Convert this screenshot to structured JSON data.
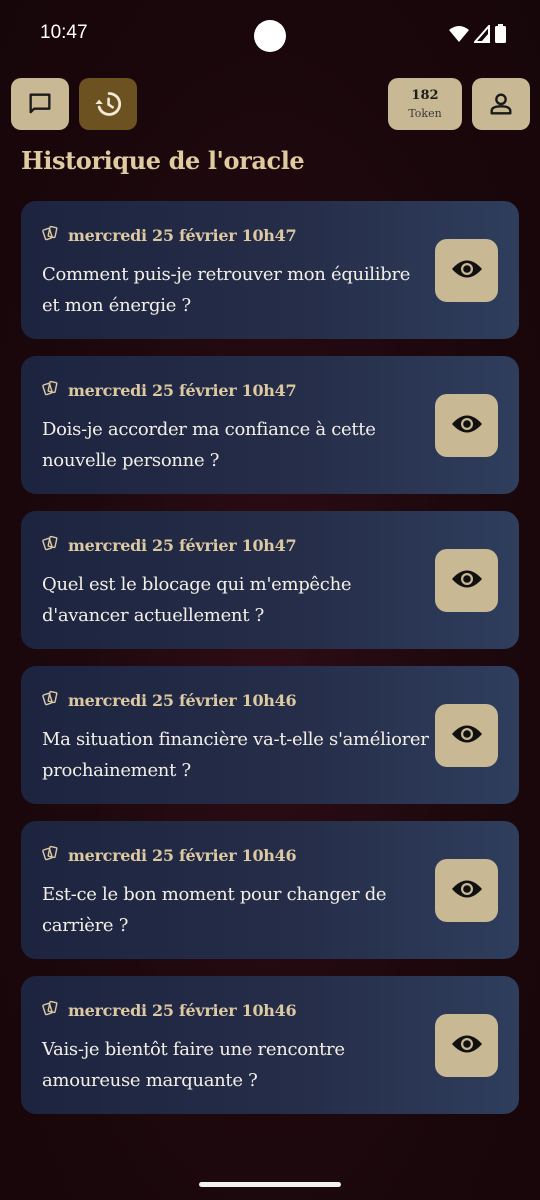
{
  "status": {
    "time": "10:47"
  },
  "header": {
    "chat_icon": "chat-bubble-icon",
    "history_icon": "history-icon",
    "token_count": "182",
    "token_label": "Token",
    "profile_icon": "person-icon"
  },
  "page_title": "Historique de l'oracle",
  "history": [
    {
      "date": "mercredi 25 février 10h47",
      "question": "Comment puis-je retrouver mon équilibre et mon énergie ?"
    },
    {
      "date": "mercredi 25 février 10h47",
      "question": "Dois-je accorder ma confiance à cette nouvelle personne ?"
    },
    {
      "date": "mercredi 25 février 10h47",
      "question": "Quel est le blocage qui m'empêche d'avancer actuellement ?"
    },
    {
      "date": "mercredi 25 février 10h46",
      "question": "Ma situation financière va-t-elle s'améliorer prochainement ?"
    },
    {
      "date": "mercredi 25 février 10h46",
      "question": "Est-ce le bon moment pour changer de carrière ?"
    },
    {
      "date": "mercredi 25 février 10h46",
      "question": "Vais-je bientôt faire une rencontre amoureuse marquante ?"
    }
  ],
  "colors": {
    "accent": "#c8b893",
    "active_tab": "#6b5220",
    "title": "#e0cba0",
    "background": "#1c080d"
  }
}
